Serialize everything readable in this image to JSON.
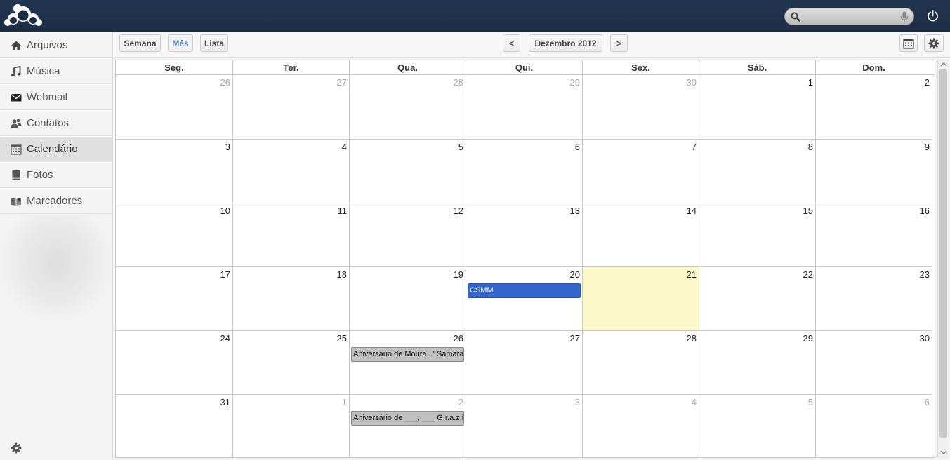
{
  "header": {
    "logo": "owncloud-logo",
    "search": {
      "placeholder": "",
      "value": ""
    }
  },
  "sidebar": {
    "items": [
      {
        "label": "Arquivos",
        "icon": "home-icon",
        "active": false
      },
      {
        "label": "Música",
        "icon": "music-icon",
        "active": false
      },
      {
        "label": "Webmail",
        "icon": "mail-icon",
        "active": false
      },
      {
        "label": "Contatos",
        "icon": "contacts-icon",
        "active": false
      },
      {
        "label": "Calendário",
        "icon": "calendar-icon",
        "active": true
      },
      {
        "label": "Fotos",
        "icon": "photos-icon",
        "active": false
      },
      {
        "label": "Marcadores",
        "icon": "bookmarks-icon",
        "active": false
      }
    ]
  },
  "toolbar": {
    "week_label": "Semana",
    "month_label": "Mês",
    "list_label": "Lista",
    "prev_label": "<",
    "next_label": ">",
    "period_label": "Dezembro 2012"
  },
  "calendar": {
    "day_names": [
      "Seg.",
      "Ter.",
      "Qua.",
      "Qui.",
      "Sex.",
      "Sáb.",
      "Dom."
    ],
    "weeks": [
      [
        {
          "d": "26",
          "o": true
        },
        {
          "d": "27",
          "o": true
        },
        {
          "d": "28",
          "o": true
        },
        {
          "d": "29",
          "o": true
        },
        {
          "d": "30",
          "o": true
        },
        {
          "d": "1",
          "o": false
        },
        {
          "d": "2",
          "o": false
        }
      ],
      [
        {
          "d": "3",
          "o": false
        },
        {
          "d": "4",
          "o": false
        },
        {
          "d": "5",
          "o": false
        },
        {
          "d": "6",
          "o": false
        },
        {
          "d": "7",
          "o": false
        },
        {
          "d": "8",
          "o": false
        },
        {
          "d": "9",
          "o": false
        }
      ],
      [
        {
          "d": "10",
          "o": false
        },
        {
          "d": "11",
          "o": false
        },
        {
          "d": "12",
          "o": false
        },
        {
          "d": "13",
          "o": false
        },
        {
          "d": "14",
          "o": false
        },
        {
          "d": "15",
          "o": false
        },
        {
          "d": "16",
          "o": false
        }
      ],
      [
        {
          "d": "17",
          "o": false
        },
        {
          "d": "18",
          "o": false
        },
        {
          "d": "19",
          "o": false
        },
        {
          "d": "20",
          "o": false
        },
        {
          "d": "21",
          "o": false,
          "today": true
        },
        {
          "d": "22",
          "o": false
        },
        {
          "d": "23",
          "o": false
        }
      ],
      [
        {
          "d": "24",
          "o": false
        },
        {
          "d": "25",
          "o": false
        },
        {
          "d": "26",
          "o": false
        },
        {
          "d": "27",
          "o": false
        },
        {
          "d": "28",
          "o": false
        },
        {
          "d": "29",
          "o": false
        },
        {
          "d": "30",
          "o": false
        }
      ],
      [
        {
          "d": "31",
          "o": false
        },
        {
          "d": "1",
          "o": true
        },
        {
          "d": "2",
          "o": true
        },
        {
          "d": "3",
          "o": true
        },
        {
          "d": "4",
          "o": true
        },
        {
          "d": "5",
          "o": true
        },
        {
          "d": "6",
          "o": true
        }
      ]
    ],
    "events": [
      {
        "title": "CSMM",
        "week": 3,
        "day": 3,
        "color": "blue"
      },
      {
        "title": "Aniversário de Moura., ' Samara",
        "week": 4,
        "day": 2,
        "color": "gray"
      },
      {
        "title": "Aniversário de ___, ___ G.r.a.z.i",
        "week": 5,
        "day": 2,
        "color": "gray"
      }
    ]
  },
  "colors": {
    "header": "#1d2d44",
    "today": "#fcf8c7",
    "event_blue": "#3366cc",
    "event_gray": "#c0c0c0",
    "active_view": "#5d8ac6"
  }
}
